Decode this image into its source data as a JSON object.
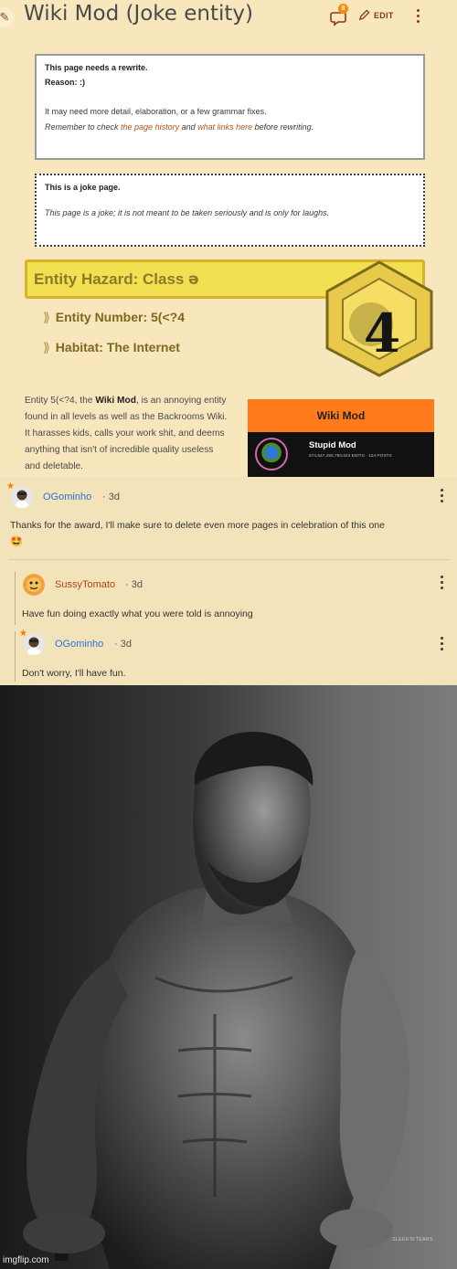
{
  "wiki": {
    "title": "Wiki Mod (Joke entity)",
    "talk_count": "8",
    "edit_label": "EDIT",
    "rewrite_box": {
      "heading": "This page needs a rewrite.",
      "reason": "Reason:  :)",
      "detail": "It may need more detail, elaboration, or a few grammar fixes.",
      "remind_prefix": "Remember to check ",
      "history_link": "the page history",
      "remind_middle": " and ",
      "links_link": "what links here",
      "remind_suffix": " before rewriting."
    },
    "joke_box": {
      "heading": "This is a joke page.",
      "text": "This page is a joke; it is not meant to be taken seriously and is only for laughs."
    },
    "hazard": {
      "label": "Entity Hazard: Class ",
      "glyph": "ə",
      "class_number": "4"
    },
    "entity_number": "Entity Number: 5(<?4",
    "habitat": "Habitat: The Internet",
    "description": {
      "prefix": "Entity 5(<?4, the ",
      "bold": "Wiki Mod",
      "suffix": ", is an annoying entity found in all levels as well as the Backrooms Wiki. It harasses kids, calls your work shit, and deems anything that isn't of incredible quality useless and deletable."
    },
    "card": {
      "title": "Wiki Mod",
      "name": "Stupid Mod",
      "stats": "574,547,456,790,643 EDITS  ·  124 POSTS"
    },
    "colors": {
      "accent": "#8a3a14",
      "hazard_yellow": "#f3e052",
      "card_orange": "#ff7a1a"
    }
  },
  "comments": [
    {
      "author": "OGominho",
      "time": "3d",
      "text": "Thanks for the award, I'll make sure to delete even more pages in celebration of this one",
      "emoji": "🤩",
      "name_color": "#2a72d8"
    },
    {
      "author": "SussyTomato",
      "time": "3d",
      "text": "Have fun doing exactly what you were told is annoying",
      "name_color": "#b0441a"
    },
    {
      "author": "OGominho",
      "time": "3d",
      "text": "Don't worry, I'll have fun.",
      "name_color": "#2a72d8"
    }
  ],
  "meme": {
    "watermark": "SLEEK'N'TEARS",
    "imgflip": "imgflip.com"
  }
}
